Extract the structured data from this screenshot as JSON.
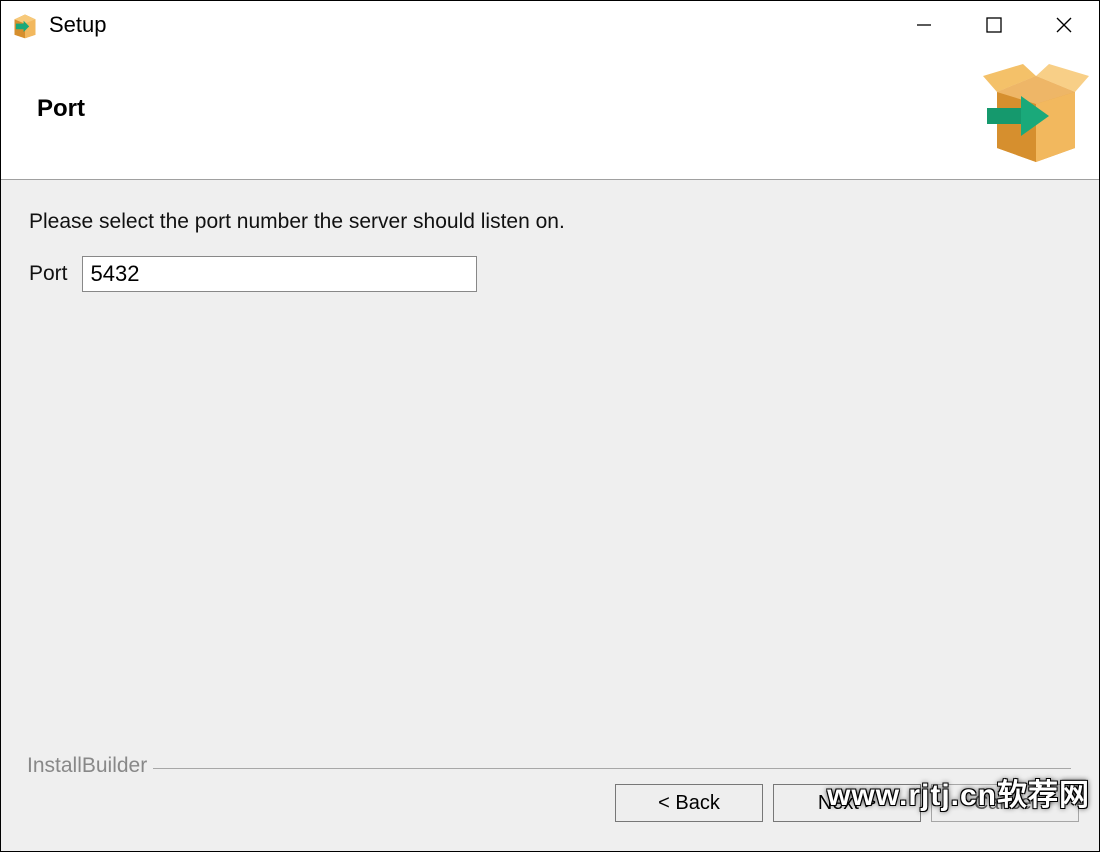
{
  "window": {
    "title": "Setup"
  },
  "header": {
    "page_title": "Port"
  },
  "content": {
    "instruction": "Please select the port number the server should listen on.",
    "field_label": "Port",
    "field_value": "5432"
  },
  "brand": {
    "legend": "InstallBuilder"
  },
  "buttons": {
    "back": "< Back",
    "next": "Next >",
    "cancel": "Cancel"
  },
  "watermark": "www.rjtj.cn软荐网"
}
